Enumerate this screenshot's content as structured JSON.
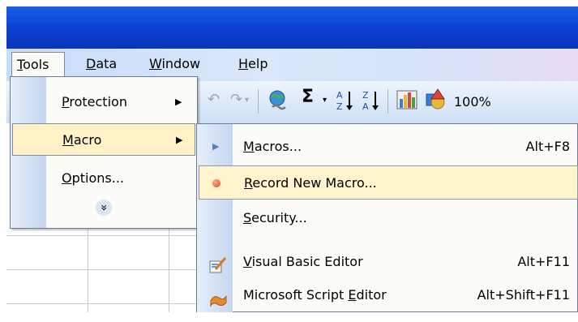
{
  "menubar": {
    "items": [
      {
        "label": "Tools",
        "accel": "T",
        "rest": "ools"
      },
      {
        "label": "Data",
        "accel": "D",
        "rest": "ata"
      },
      {
        "label": "Window",
        "accel": "W",
        "rest": "indow"
      },
      {
        "label": "Help",
        "accel": "H",
        "rest": "elp"
      }
    ]
  },
  "toolbar": {
    "sigma": "Σ",
    "zoom": "100%"
  },
  "tools_menu": {
    "items": [
      {
        "pre": "",
        "accel": "P",
        "rest": "rotection",
        "has_submenu": true
      },
      {
        "pre": "",
        "accel": "M",
        "rest": "acro",
        "has_submenu": true,
        "highlighted": true
      },
      {
        "pre": "",
        "accel": "O",
        "rest": "ptions...",
        "has_submenu": false
      }
    ],
    "expand_glyph": "»"
  },
  "macro_submenu": {
    "items": [
      {
        "pre": "",
        "accel": "M",
        "rest": "acros...",
        "shortcut": "Alt+F8",
        "icon": "play-icon"
      },
      {
        "pre": "",
        "accel": "R",
        "rest": "ecord New Macro...",
        "shortcut": "",
        "icon": "record-icon",
        "highlighted": true
      },
      {
        "pre": "",
        "accel": "S",
        "rest": "ecurity...",
        "shortcut": "",
        "icon": ""
      },
      {
        "pre": "",
        "accel": "V",
        "rest": "isual Basic Editor",
        "shortcut": "Alt+F11",
        "icon": "vb-editor-icon"
      },
      {
        "pre": "Microsoft Script ",
        "accel": "E",
        "rest": "ditor",
        "shortcut": "Alt+Shift+F11",
        "icon": "script-editor-icon"
      }
    ]
  },
  "colors": {
    "titlebar": "#0b3ed1",
    "menu_highlight": "#fff2c7",
    "menu_gutter": "#c4d6f0"
  }
}
